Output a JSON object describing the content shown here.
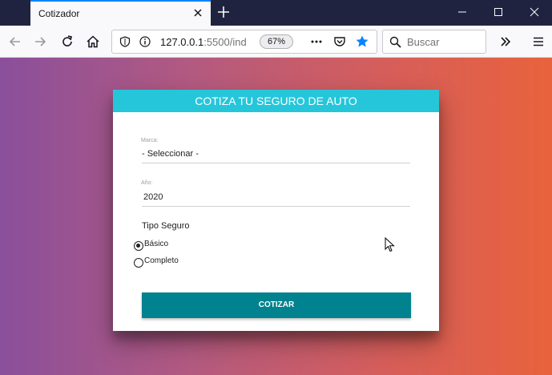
{
  "browser": {
    "tab_title": "Cotizador",
    "url_host": "127.0.0.1",
    "url_rest": ":5500/ind",
    "zoom": "67%",
    "search_placeholder": "Buscar"
  },
  "form": {
    "header": "COTIZA TU SEGURO DE AUTO",
    "marca_label": "Marca:",
    "marca_value": "- Seleccionar -",
    "year_label": "Año:",
    "year_value": "2020",
    "tipo_title": "Tipo Seguro",
    "options": [
      {
        "label": "Básico",
        "checked": true
      },
      {
        "label": "Completo",
        "checked": false
      }
    ],
    "submit_label": "COTIZAR"
  },
  "colors": {
    "header": "#26c6da",
    "button": "#00838f",
    "gradient_left": "#8a4f9b",
    "gradient_right": "#e8623c"
  }
}
